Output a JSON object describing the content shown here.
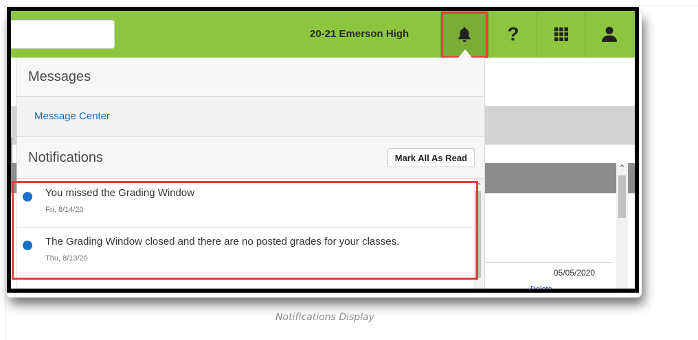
{
  "header": {
    "school_year": "20-21 Emerson High",
    "icons": [
      "bell-icon",
      "help-icon",
      "app-grid-icon",
      "user-icon"
    ],
    "accent_color": "#8cc63f",
    "highlight_color": "#e0403c"
  },
  "messages": {
    "title": "Messages",
    "message_center_link": "Message Center"
  },
  "notifications": {
    "title": "Notifications",
    "mark_all_label": "Mark All As Read",
    "items": [
      {
        "text": "You missed the Grading Window",
        "date": "Fri, 8/14/20",
        "unread": true
      },
      {
        "text": "The Grading Window closed and there are no posted grades for your classes.",
        "date": "Thu, 8/13/20",
        "unread": true
      }
    ]
  },
  "background": {
    "date": "05/05/2020",
    "link": "Delete"
  },
  "caption": "Notifications Display"
}
